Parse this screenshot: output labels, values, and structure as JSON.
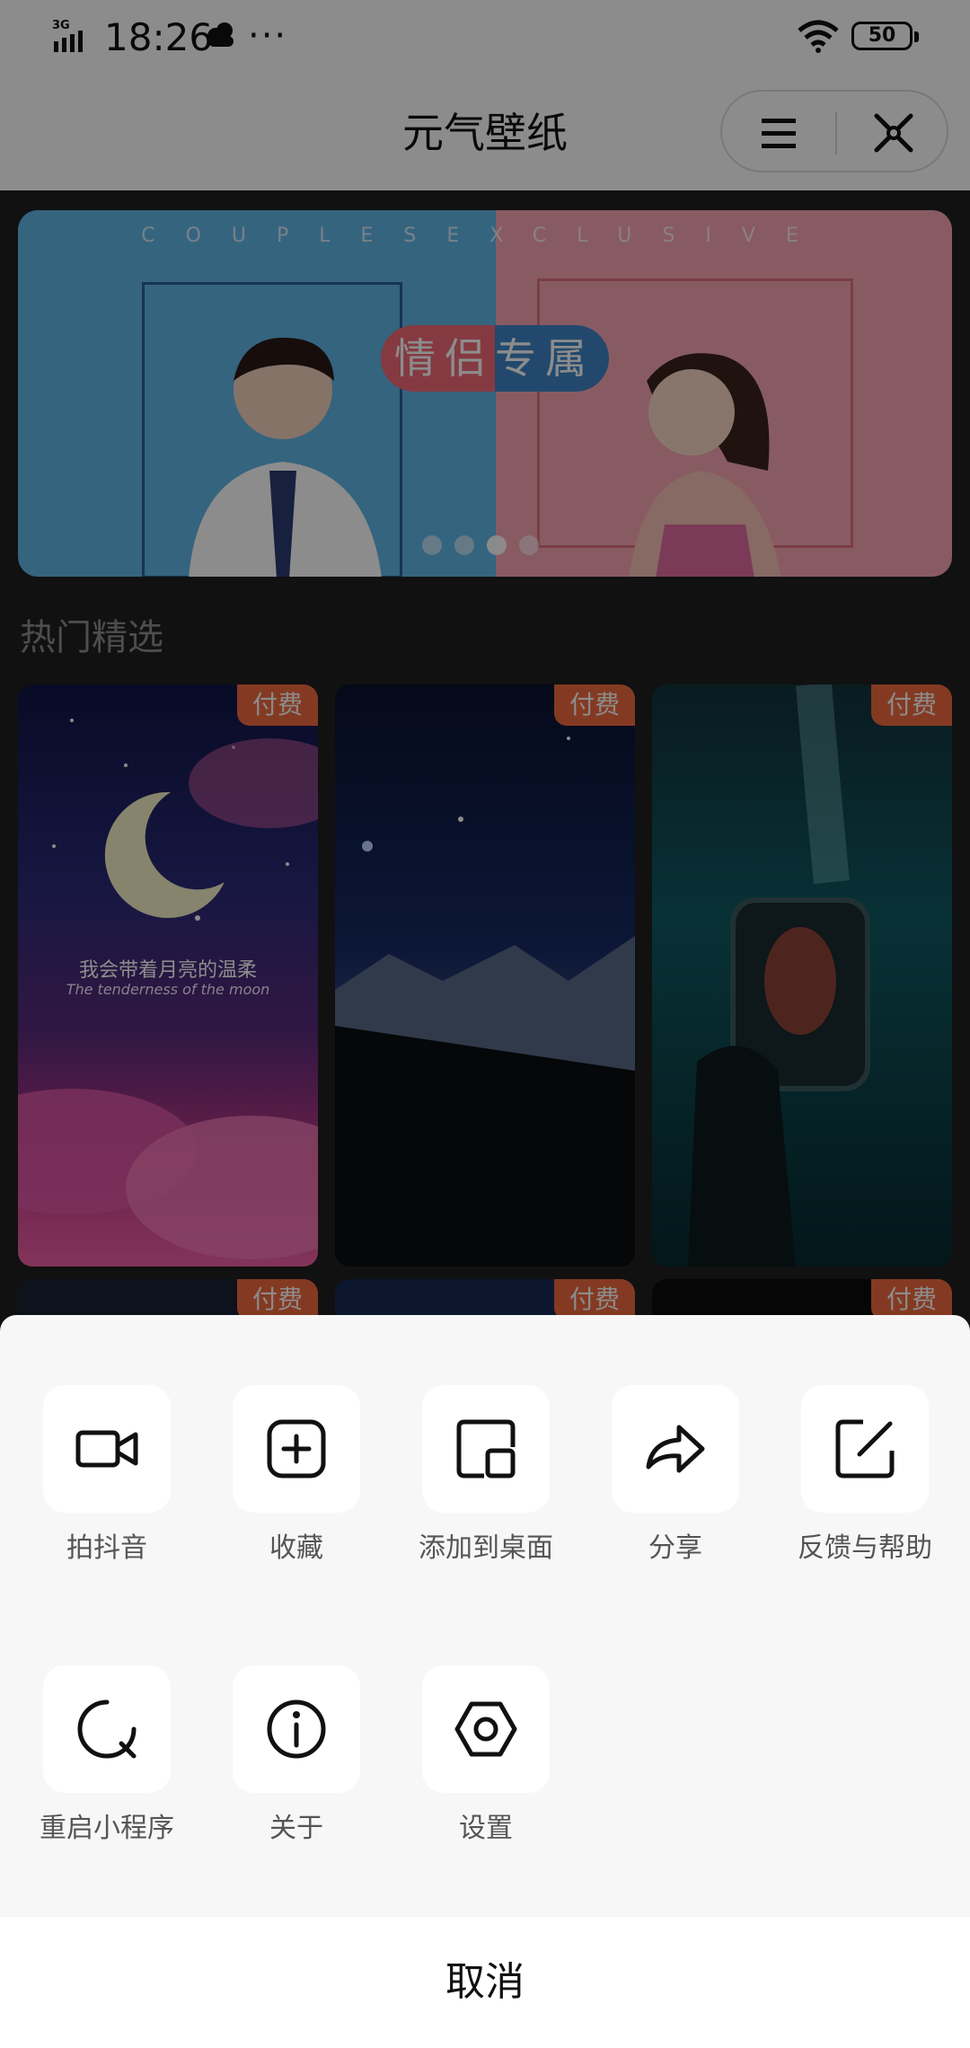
{
  "status_bar": {
    "network": "3G",
    "time": "18:26",
    "dots": "···",
    "battery": "50"
  },
  "nav": {
    "title": "元气壁纸"
  },
  "banner": {
    "tagline": "COUPLESEXCLUSIVE",
    "pill_text": "情侣专属",
    "page_count": 4,
    "active_index": 2
  },
  "section": {
    "title": "热门精选"
  },
  "cards": [
    {
      "badge": "付费",
      "text_cn": "我会带着月亮的温柔",
      "text_en": "The tenderness of the moon"
    },
    {
      "badge": "付费"
    },
    {
      "badge": "付费"
    },
    {
      "badge": "付费"
    },
    {
      "badge": "付费"
    },
    {
      "badge": "付费"
    }
  ],
  "action_sheet": {
    "row1": [
      {
        "label": "拍抖音",
        "icon": "video-camera-icon"
      },
      {
        "label": "收藏",
        "icon": "add-square-icon"
      },
      {
        "label": "添加到桌面",
        "icon": "add-to-desktop-icon"
      },
      {
        "label": "分享",
        "icon": "share-arrow-icon"
      },
      {
        "label": "反馈与帮助",
        "icon": "edit-feedback-icon"
      }
    ],
    "row2": [
      {
        "label": "重启小程序",
        "icon": "restart-icon"
      },
      {
        "label": "关于",
        "icon": "info-icon"
      },
      {
        "label": "设置",
        "icon": "settings-hexagon-icon"
      }
    ],
    "cancel": "取消"
  },
  "colors": {
    "badge": "#f06a3f",
    "sheet_bg": "#f7f7f7",
    "page_bg": "#1f1f1f"
  }
}
